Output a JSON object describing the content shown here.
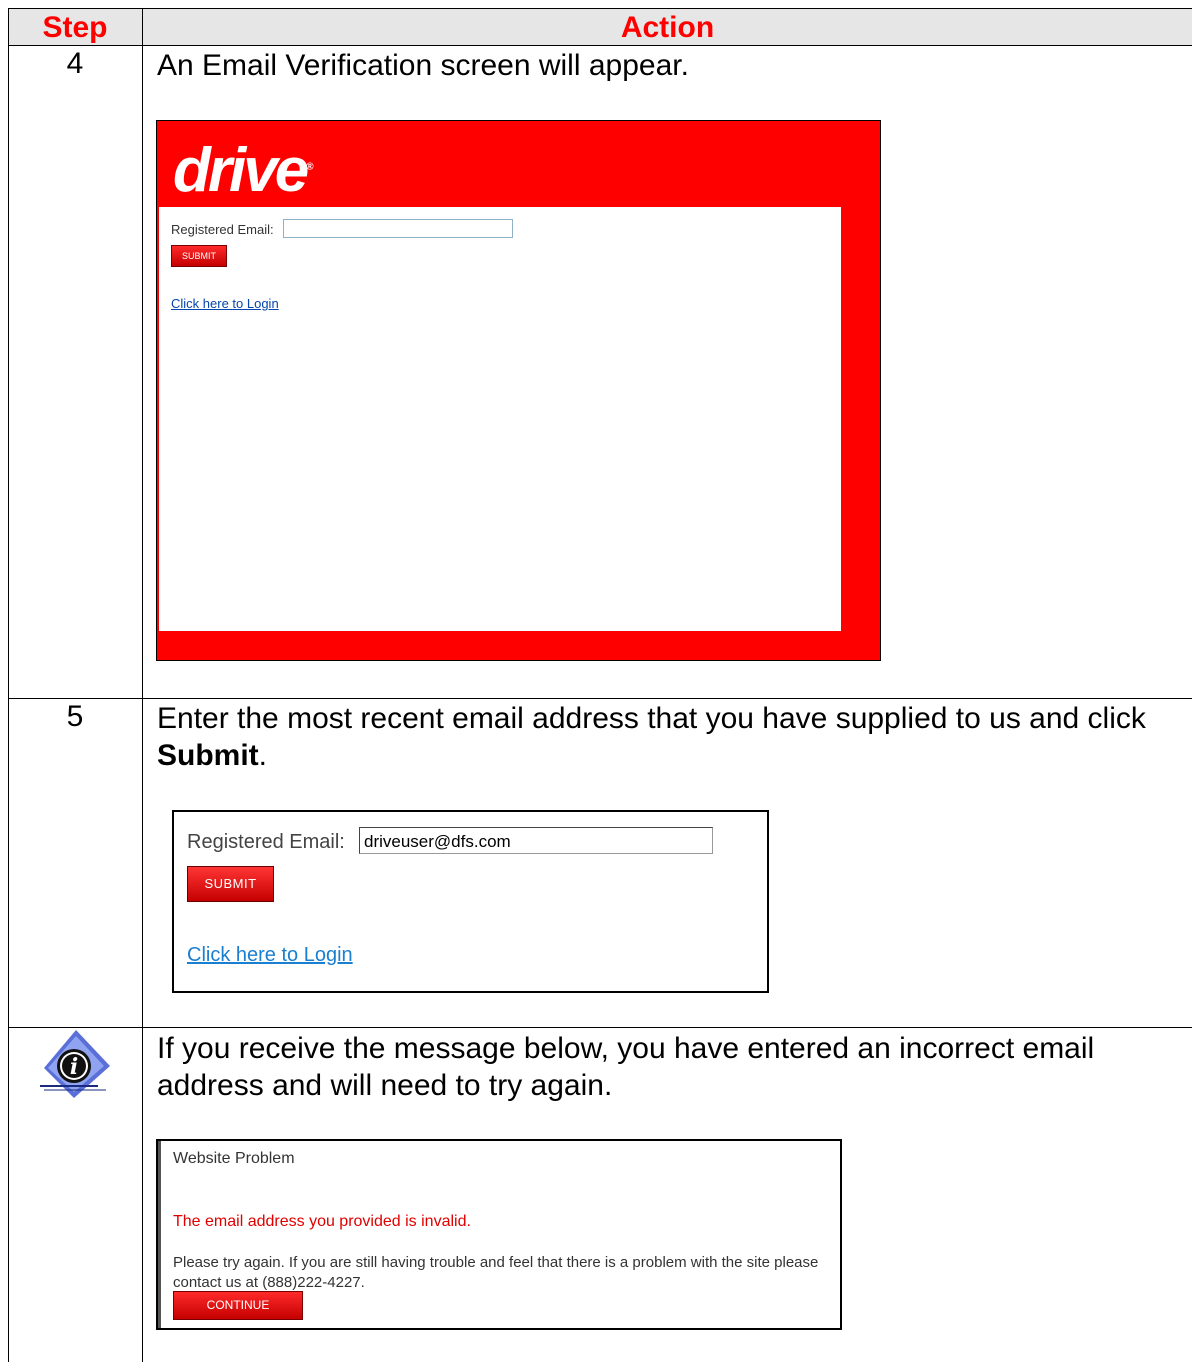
{
  "header": {
    "step": "Step",
    "action": "Action"
  },
  "rows": [
    {
      "step": "4",
      "text": "An Email Verification screen will appear.",
      "screenshot": {
        "logo": "drive",
        "logo_mark": "®",
        "email_label": "Registered Email:",
        "email_value": "",
        "submit_label": "SUBMIT",
        "login_link": "Click here to Login"
      }
    },
    {
      "step": "5",
      "text_before": "Enter the most recent email address that you have supplied to us and click ",
      "text_bold": "Submit",
      "text_after": ".",
      "screenshot": {
        "email_label": "Registered Email:",
        "email_value": "driveuser@dfs.com",
        "submit_label": "SUBMIT",
        "login_link": "Click here to Login"
      }
    },
    {
      "icon": "info-icon",
      "text": "If you receive the message below, you have entered an incorrect email address and will need to try again.",
      "screenshot": {
        "title": "Website Problem",
        "error": "The email address you provided is invalid.",
        "message": "Please try again.  If you are still having trouble and feel that there is a problem with the site please contact us at (888)222-4227.",
        "continue_label": "CONTINUE"
      }
    }
  ],
  "colors": {
    "header_text": "#ff0000",
    "header_bg": "#e6e6e6",
    "brand_red": "#ff0000",
    "link": "#0645ad"
  }
}
